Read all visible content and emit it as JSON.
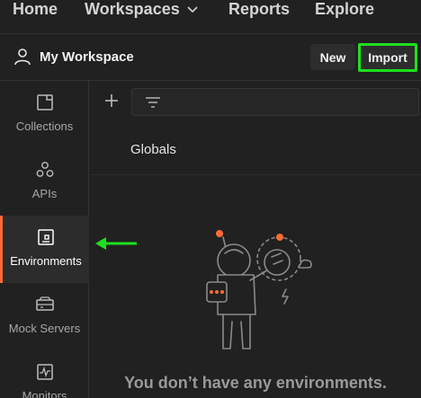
{
  "topnav": {
    "home": "Home",
    "workspaces": "Workspaces",
    "reports": "Reports",
    "explore": "Explore"
  },
  "workspace": {
    "title": "My Workspace",
    "new_label": "New",
    "import_label": "Import"
  },
  "sidebar": {
    "items": [
      {
        "label": "Collections",
        "icon": "collections-icon"
      },
      {
        "label": "APIs",
        "icon": "apis-icon"
      },
      {
        "label": "Environments",
        "icon": "environments-icon",
        "active": true
      },
      {
        "label": "Mock Servers",
        "icon": "mock-servers-icon"
      },
      {
        "label": "Monitors",
        "icon": "monitors-icon"
      }
    ]
  },
  "environments": {
    "globals_label": "Globals",
    "empty_title": "You don’t have any environments."
  },
  "colors": {
    "background": "#212121",
    "active_accent": "#ff6c37",
    "highlight_green": "#1ee01e"
  }
}
